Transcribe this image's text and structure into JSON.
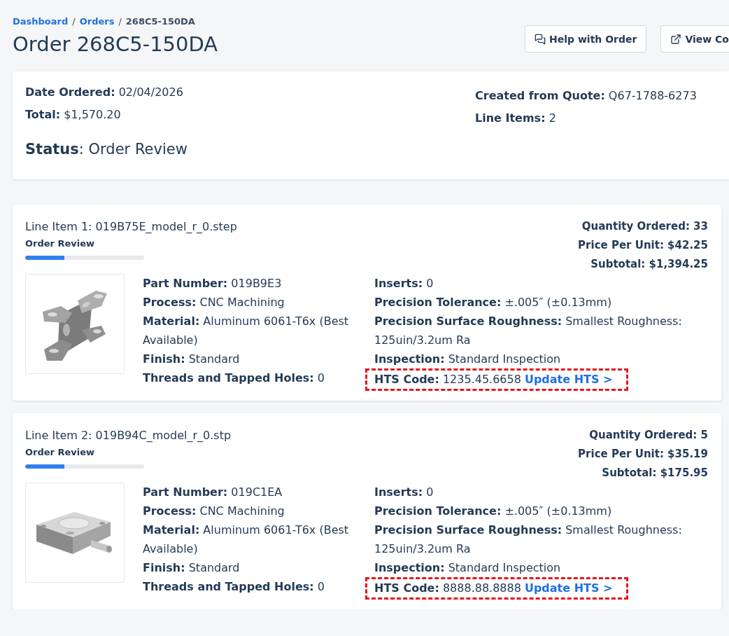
{
  "breadcrumb": [
    {
      "label": "Dashboard",
      "kind": "link"
    },
    {
      "label": "/",
      "kind": "separator"
    },
    {
      "label": "Orders",
      "kind": "link"
    },
    {
      "label": "/",
      "kind": "separator"
    },
    {
      "label": "268C5-150DA",
      "kind": "current"
    }
  ],
  "title": "Order 268C5-150DA",
  "actions": [
    {
      "label": "Help with Order",
      "kind": "help"
    },
    {
      "label": "View Co",
      "kind": "external"
    }
  ],
  "summary": {
    "left": [
      "**Date Ordered:** 02/04/2026",
      "**Total:** $1,570.20"
    ],
    "status": "**Status**: Order Review",
    "right": [
      "**Created from Quote:** Q67-1788-6273",
      "**Line Items:** 2"
    ]
  },
  "line_items": [
    {
      "title": "Line Item 1: 019B75E_model_r_0.step",
      "status": "Order Review",
      "level": 0.33,
      "totals": [
        "Quantity Ordered: 33",
        "Price Per Unit: $42.25",
        "Subtotal: $1,394.25"
      ],
      "details_left": [
        "**Part Number:** 019B9E3",
        "**Process:** CNC Machining",
        "**Material:** Aluminum 6061-T6x (Best Available)",
        "**Finish:** Standard",
        "**Threads and Tapped Holes:** 0"
      ],
      "details_right": [
        "**Inserts:** 0",
        "**Precision Tolerance:** ±.005″ (±0.13mm)",
        "**Precision Surface Roughness:** Smallest Roughness: 125uin/3.2um Ra",
        "**Inspection:** Standard Inspection"
      ],
      "hts": {
        "text": "**HTS Code:** 1235.45.6658",
        "link": "Update HTS >",
        "highlighted": true
      }
    },
    {
      "title": "Line Item 2: 019B94C_model_r_0.stp",
      "status": "Order Review",
      "level": 0.33,
      "totals": [
        "Quantity Ordered: 5",
        "Price Per Unit: $35.19",
        "Subtotal: $175.95"
      ],
      "details_left": [
        "**Part Number:** 019C1EA",
        "**Process:** CNC Machining",
        "**Material:** Aluminum 6061-T6x (Best Available)",
        "**Finish:** Standard",
        "**Threads and Tapped Holes:** 0"
      ],
      "details_right": [
        "**Inserts:** 0",
        "**Precision Tolerance:** ±.005″ (±0.13mm)",
        "**Precision Surface Roughness:** Smallest Roughness: 125uin/3.2um Ra",
        "**Inspection:** Standard Inspection"
      ],
      "hts": {
        "text": "**HTS Code:** 8888.88.8888",
        "link": "Update HTS >",
        "highlighted": true
      }
    }
  ]
}
